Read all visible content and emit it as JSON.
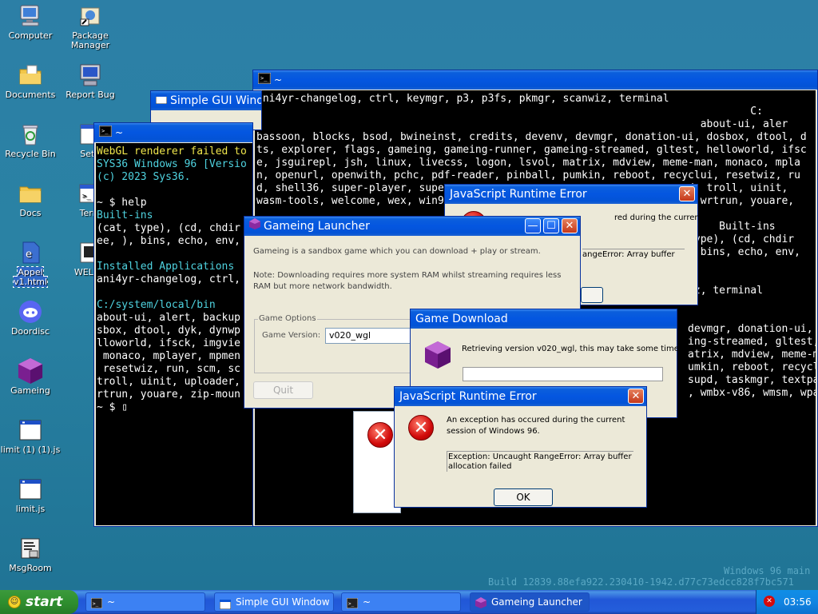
{
  "desktop_icons": [
    {
      "label": "Computer",
      "icon": "computer-icon"
    },
    {
      "label": "Package Manager",
      "icon": "package-manager-icon"
    },
    {
      "label": "Documents",
      "icon": "documents-folder-icon"
    },
    {
      "label": "Report Bug",
      "icon": "report-bug-icon"
    },
    {
      "label": "Recycle Bin",
      "icon": "recycle-bin-icon"
    },
    {
      "label": "Setti",
      "icon": "settings-icon"
    },
    {
      "label": "Docs",
      "icon": "folder-icon"
    },
    {
      "label": "Term",
      "icon": "terminal-icon"
    },
    {
      "label": "Appel v1.html",
      "icon": "html-file-icon"
    },
    {
      "label": "WELCO",
      "icon": "welcome-icon"
    },
    {
      "label": "Doordisc",
      "icon": "discord-icon"
    },
    {
      "label": "Gameing",
      "icon": "gameing-icon"
    },
    {
      "label": "limit (1) (1).js",
      "icon": "js-file-icon"
    },
    {
      "label": "limit.js",
      "icon": "js-file-icon"
    },
    {
      "label": "MsgRoom",
      "icon": "msgroom-icon"
    }
  ],
  "terminal_back": {
    "title": "~",
    "lines": [
      "ani4yr-changelog, ctrl, keymgr, p3, p3fs, pkmgr, scanwiz, terminal",
      "                                                                               C:",
      "                                                                       about-ui, aler",
      "bassoon, blocks, bsod, bwineinst, credits, devenv, devmgr, donation-ui, dosbox, dtool, d",
      "ts, explorer, flags, gameing, gameing-runner, gameing-streamed, gltest, helloworld, ifsc",
      "e, jsguirepl, jsh, linux, livecss, logon, lsvol, matrix, mdview, meme-man, monaco, mpla",
      "n, openurl, openwith, pchc, pdf-reader, pinball, pumkin, reboot, recyclui, resetwiz, ru",
      "d, shell36, super-player, supe                                     pad, troll, uinit,",
      "wasm-tools, welcome, wex, win9                                     pa, wrtrun, youare,",
      "",
      "                                                                          Built-ins",
      "                                                                     type), (cd, chdir",
      "                                                                     , bins, echo, env,",
      "",
      "",
      "                                                                     iz, terminal",
      "",
      "",
      "                                                                     devmgr, donation-ui,",
      "                                                                     ing-streamed, gltest,",
      "                                                                     atrix, mdview, meme-ma",
      "                                                                     umkin, reboot, recyclu",
      "                                                                     supd, taskmgr, textpad",
      "                                                                     , wmbx-v86, wmsm, wpa,"
    ]
  },
  "simple_gui": {
    "title": "Simple GUI Windo"
  },
  "terminal_front": {
    "title": "~",
    "lines": [
      {
        "t": "WebGL renderer failed to",
        "c": "yellow"
      },
      {
        "t": "SYS36 Windows 96 [Versio",
        "c": "cyan"
      },
      {
        "t": "(c) 2023 Sys36.",
        "c": "cyan"
      },
      {
        "t": "",
        "c": ""
      },
      {
        "t": "~ $ help",
        "c": ""
      },
      {
        "t": "Built-ins",
        "c": "cyan"
      },
      {
        "t": "(cat, type), (cd, chdir",
        "c": ""
      },
      {
        "t": "ee, ), bins, echo, env,",
        "c": ""
      },
      {
        "t": "",
        "c": ""
      },
      {
        "t": "Installed Applications",
        "c": "cyan"
      },
      {
        "t": "ani4yr-changelog, ctrl,",
        "c": ""
      },
      {
        "t": "",
        "c": ""
      },
      {
        "t": "C:/system/local/bin",
        "c": "cyan"
      },
      {
        "t": "about-ui, alert, backup",
        "c": ""
      },
      {
        "t": "sbox, dtool, dyk, dynwp",
        "c": ""
      },
      {
        "t": "lloworld, ifsck, imgvie",
        "c": ""
      },
      {
        "t": " monaco, mplayer, mpmen",
        "c": ""
      },
      {
        "t": " resetwiz, run, scm, sc",
        "c": ""
      },
      {
        "t": "troll, uinit, uploader,",
        "c": ""
      },
      {
        "t": "rtrun, youare, zip-moun",
        "c": ""
      },
      {
        "t": "~ $ ▯",
        "c": ""
      }
    ]
  },
  "launcher": {
    "title": "Gameing Launcher",
    "desc": "Gameing is a sandbox game which you can download + play or stream.",
    "note": "Note: Downloading requires more system RAM whilst streaming requires less RAM but more network bandwidth.",
    "group": "Game Options",
    "version_label": "Game Version:",
    "version_value": "v020_wgl",
    "quit": "Quit"
  },
  "error_back": {
    "title": "JavaScript Runtime Error",
    "msg": "red during the current",
    "exc": "angeError: Array buffer"
  },
  "download": {
    "title": "Game Download",
    "msg": "Retrieving version v020_wgl, this may take some time...",
    "progress": 0
  },
  "error_front": {
    "title": "JavaScript Runtime Error",
    "msg": "An exception has occured during the current session of Windows 96.",
    "exc": "Exception: Uncaught RangeError: Array buffer allocation failed",
    "ok": "OK"
  },
  "watermark": {
    "line1": "Windows 96 main",
    "line2": "Build 12839.88efa922.230410-1942.d77c73edcc828f7bc571"
  },
  "taskbar": {
    "start": "start",
    "tasks": [
      "~",
      "Simple GUI Window",
      "~",
      "Gameing Launcher"
    ],
    "clock": "03:56"
  }
}
